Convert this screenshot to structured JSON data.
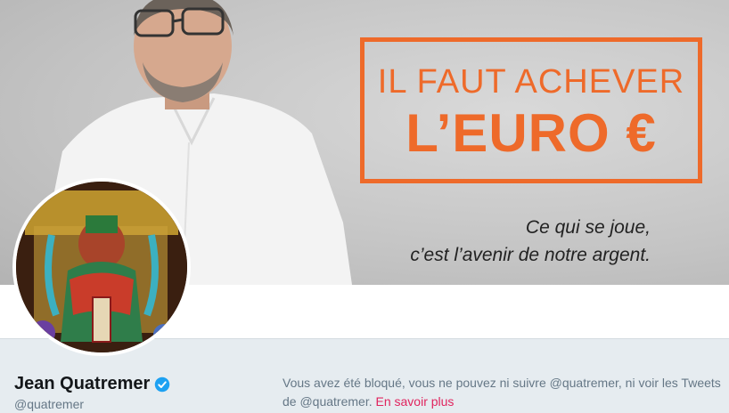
{
  "banner": {
    "promo_line1": "IL FAUT ACHEVER",
    "promo_line2": "L’EURO €",
    "tagline_1": "Ce qui se joue,",
    "tagline_2": "c’est l’avenir de notre argent."
  },
  "profile": {
    "name": "Jean Quatremer",
    "handle": "@quatremer",
    "verified": true
  },
  "blocked_notice": {
    "text": "Vous avez été bloqué, vous ne pouvez ni suivre @quatremer, ni voir les Tweets de @quatremer.",
    "link": "En savoir plus"
  },
  "colors": {
    "accent_orange": "#ee6a2a",
    "link_red": "#e0245e",
    "verified_blue": "#1da1f2"
  }
}
